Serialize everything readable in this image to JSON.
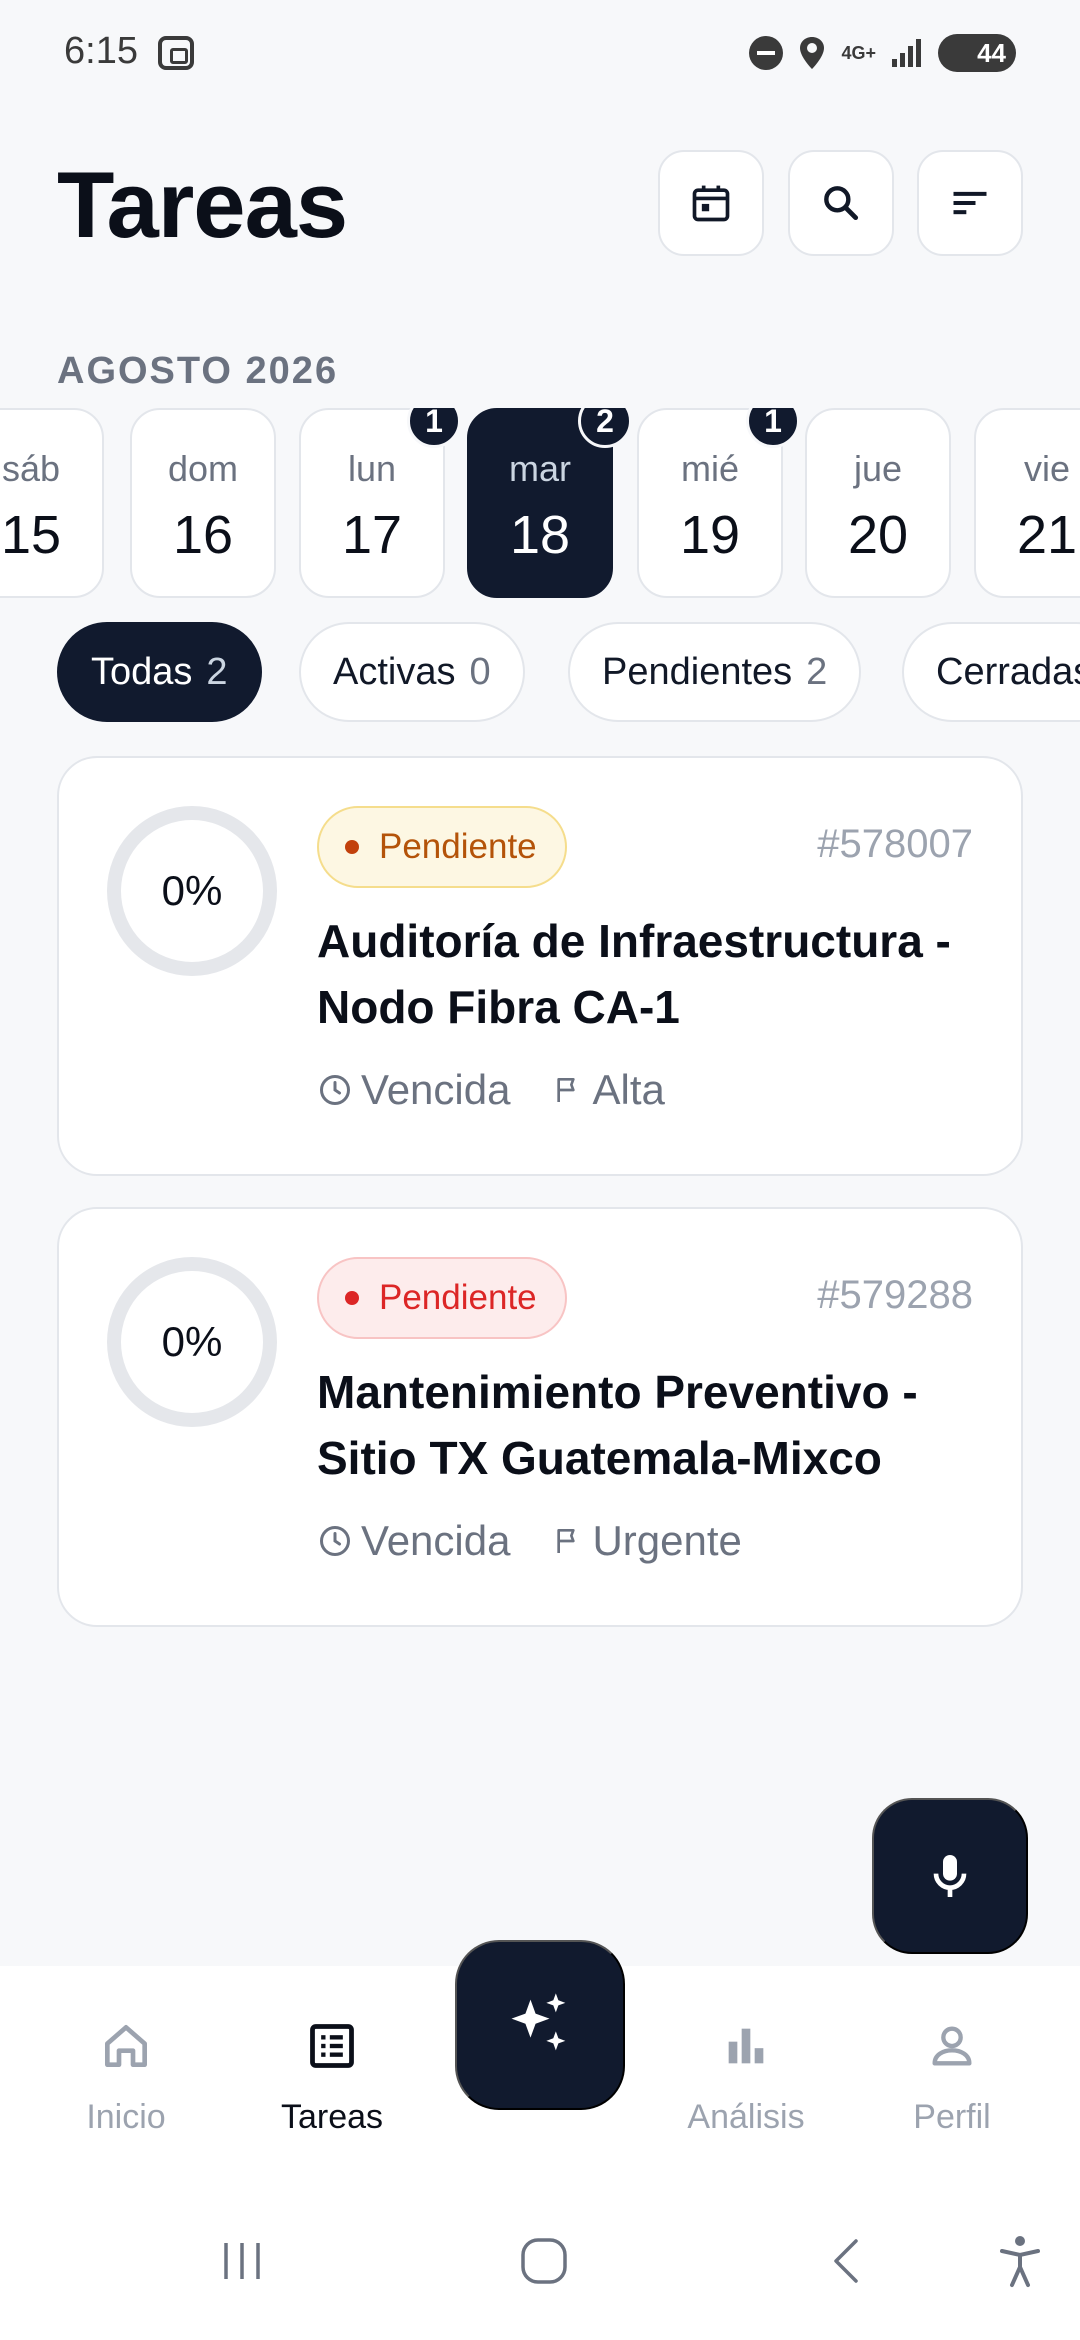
{
  "status_bar": {
    "time": "6:15",
    "network": "4G+",
    "battery": "44"
  },
  "header": {
    "title": "Tareas",
    "icons": [
      "calendar-icon",
      "search-icon",
      "sort-icon"
    ]
  },
  "calendar": {
    "month": "AGOSTO 2026",
    "days": [
      {
        "name": "sáb",
        "date": "15",
        "badge": ""
      },
      {
        "name": "dom",
        "date": "16",
        "badge": ""
      },
      {
        "name": "lun",
        "date": "17",
        "badge": "1"
      },
      {
        "name": "mar",
        "date": "18",
        "badge": "2",
        "selected": true
      },
      {
        "name": "mié",
        "date": "19",
        "badge": "1"
      },
      {
        "name": "jue",
        "date": "20",
        "badge": ""
      },
      {
        "name": "vie",
        "date": "21",
        "badge": ""
      }
    ]
  },
  "filters": [
    {
      "label": "Todas",
      "count": "2",
      "active": true
    },
    {
      "label": "Activas",
      "count": "0"
    },
    {
      "label": "Pendientes",
      "count": "2"
    },
    {
      "label": "Cerradas",
      "count": ""
    }
  ],
  "tasks": [
    {
      "progress": "0%",
      "status": "Pendiente",
      "id": "#578007",
      "title": "Auditoría de Infraestructura - Nodo Fibra CA-1",
      "due": "Vencida",
      "priority": "Alta"
    },
    {
      "progress": "0%",
      "status": "Pendiente",
      "id": "#579288",
      "title": "Mantenimiento Preventivo - Sitio TX Guatemala-Mixco",
      "due": "Vencida",
      "priority": "Urgente"
    }
  ],
  "nav": [
    {
      "label": "Inicio",
      "icon": "home-icon"
    },
    {
      "label": "Tareas",
      "icon": "tasks-icon",
      "active": true
    },
    {
      "label": "Análisis",
      "icon": "chart-icon"
    },
    {
      "label": "Perfil",
      "icon": "profile-icon"
    }
  ],
  "colors": {
    "primary": "#111a2e",
    "background": "#f7f8fa",
    "pending_amber": "#b45309",
    "pending_red": "#dc2626"
  }
}
